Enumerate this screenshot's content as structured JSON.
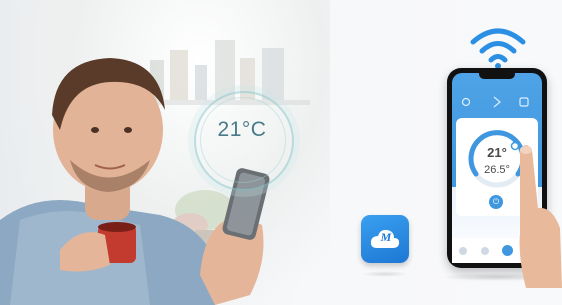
{
  "banner": {
    "temperature_bubble": "21°C"
  },
  "app_screen": {
    "set_temperature": "21°",
    "current_temperature": "26.5°",
    "power_symbol": "⏻"
  },
  "app_icon": {
    "letter": "M"
  },
  "colors": {
    "accent_blue": "#3f97df",
    "icon_blue": "#1d77d4",
    "temp_text": "#4a7a8a"
  },
  "icons": [
    "wifi-icon",
    "app-cloud-icon",
    "power-icon"
  ]
}
